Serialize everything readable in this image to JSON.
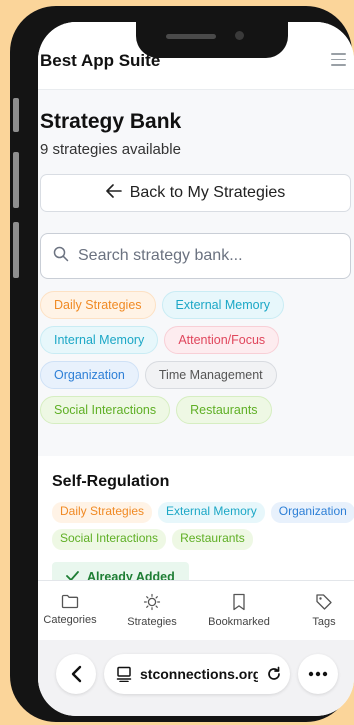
{
  "app": {
    "brand": "Best App Suite"
  },
  "page": {
    "title": "Strategy Bank",
    "subtitle": "9 strategies available",
    "back_label": "Back to My Strategies",
    "search_placeholder": "Search strategy bank..."
  },
  "filters": [
    [
      "Daily Strategies",
      "External Memory"
    ],
    [
      "Internal Memory",
      "Attention/Focus"
    ],
    [
      "Organization",
      "Time Management"
    ],
    [
      "Social Interactions",
      "Restaurants"
    ]
  ],
  "card": {
    "title": "Self-Regulation",
    "tags_row1": [
      "Daily Strategies",
      "External Memory",
      "Organization"
    ],
    "tags_row2": [
      "Social Interactions",
      "Restaurants"
    ],
    "status": "Already Added"
  },
  "tabs": [
    "Categories",
    "Strategies",
    "Bookmarked",
    "Tags"
  ],
  "browser": {
    "url": "stconnections.org"
  },
  "colors": {
    "background": "#fbd59a",
    "tag_orange": "#f08a24",
    "tag_teal": "#1ba7c6",
    "tag_red": "#e0465c",
    "tag_blue": "#2d7fd6",
    "tag_green": "#5faf25",
    "added_green": "#1e7e34"
  }
}
